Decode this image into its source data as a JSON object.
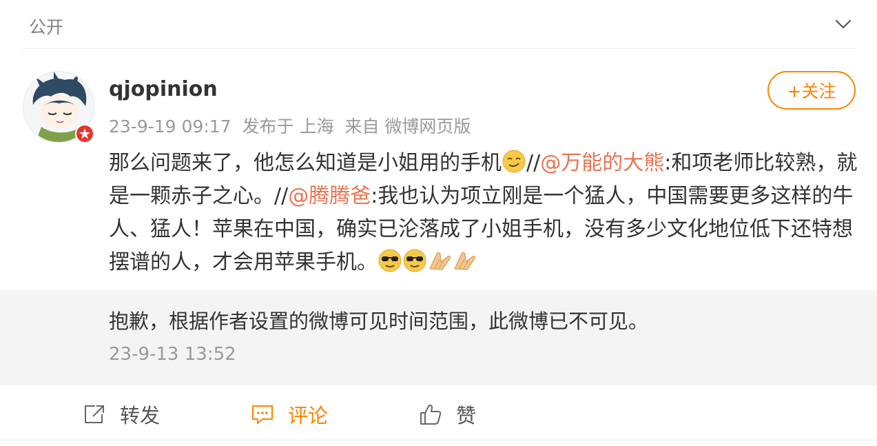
{
  "header": {
    "visibility_label": "公开",
    "expand_icon": "chevron-down-icon"
  },
  "post": {
    "username": "qjopinion",
    "time": "23-9-19 09:17",
    "published_at": "发布于 上海",
    "source": "来自 微博网页版",
    "follow_label": "+关注",
    "content": {
      "part1": "那么问题来了，他怎么知道是小姐用的手机",
      "sep1": "//",
      "mention1": "@万能的大熊",
      "part2": ":和项老师比较熟，就是一颗赤子之心。//",
      "mention2": "@腾腾爸",
      "part3": ":我也认为项立刚是一个猛人，中国需要更多这样的牛人、猛人！苹果在中国，确实已沦落成了小姐手机，没有多少文化地位低下还特想摆谱的人，才会用苹果手机。"
    },
    "emojis": [
      "smirk-emoji",
      "cool-emoji",
      "cool-emoji",
      "clap-emoji",
      "clap-emoji"
    ]
  },
  "retweet": {
    "notice": "抱歉，根据作者设置的微博可见时间范围，此微博已不可见。",
    "time": "23-9-13 13:52"
  },
  "actions": {
    "repost_label": "转发",
    "comment_label": "评论",
    "like_label": "赞"
  },
  "colors": {
    "accent": "#ff8200",
    "mention": "#eb7350",
    "muted": "#999999",
    "retweet_bg": "#f4f4f4"
  }
}
